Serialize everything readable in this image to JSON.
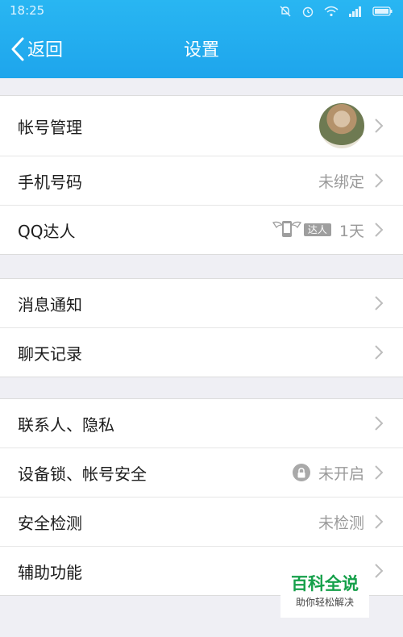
{
  "status_bar": {
    "time": "18:25",
    "icons": [
      "mute-icon",
      "alarm-icon",
      "wifi-icon",
      "signal-icon",
      "battery-icon"
    ]
  },
  "navbar": {
    "back_label": "返回",
    "title": "设置"
  },
  "groups": [
    {
      "rows": [
        {
          "label": "帐号管理",
          "value": "",
          "extra": "avatar"
        },
        {
          "label": "手机号码",
          "value": "未绑定",
          "extra": ""
        },
        {
          "label": "QQ达人",
          "value": "1天",
          "extra": "daren-badge",
          "badge_text": "达人"
        }
      ]
    },
    {
      "rows": [
        {
          "label": "消息通知",
          "value": "",
          "extra": ""
        },
        {
          "label": "聊天记录",
          "value": "",
          "extra": ""
        }
      ]
    },
    {
      "rows": [
        {
          "label": "联系人、隐私",
          "value": "",
          "extra": ""
        },
        {
          "label": "设备锁、帐号安全",
          "value": "未开启",
          "extra": "lock"
        },
        {
          "label": "安全检测",
          "value": "未检测",
          "extra": ""
        },
        {
          "label": "辅助功能",
          "value": "",
          "extra": ""
        }
      ]
    }
  ],
  "watermark": {
    "title": "百科全说",
    "subtitle": "助你轻松解决"
  },
  "colors": {
    "header": "#1ea5ec",
    "background": "#efeff4",
    "watermark_green": "#15a04a"
  }
}
